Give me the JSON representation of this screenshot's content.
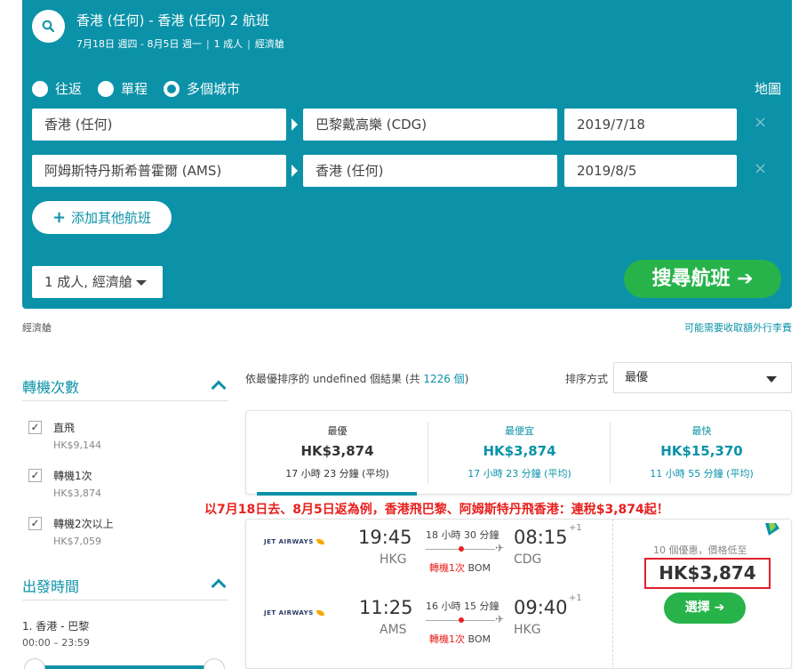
{
  "search": {
    "route_title": "香港 (任何) - 香港 (任何) 2 航班",
    "dates": "7月18日 週四 - 8月5日 週一",
    "pax": "1 成人",
    "cabin": "經濟艙"
  },
  "trip_types": [
    {
      "label": "往返",
      "selected": false
    },
    {
      "label": "單程",
      "selected": false
    },
    {
      "label": "多個城市",
      "selected": true
    }
  ],
  "map_label": "地圖",
  "legs": [
    {
      "from": "香港 (任何)",
      "to": "巴黎戴高樂 (CDG)",
      "date": "2019/7/18"
    },
    {
      "from": "阿姆斯特丹斯希普霍爾 (AMS)",
      "to": "香港 (任何)",
      "date": "2019/8/5"
    }
  ],
  "remove_symbol": "×",
  "add_flight_label": "添加其他航班",
  "pax_select": "1 成人, 經濟艙",
  "search_button": "搜尋航班",
  "cabin_note": "經濟艙",
  "baggage_note": "可能需要收取額外行李費",
  "filters": {
    "stops_title": "轉機次數",
    "stops": [
      {
        "label": "直飛",
        "price": "HK$9,144",
        "checked": true
      },
      {
        "label": "轉機1次",
        "price": "HK$3,874",
        "checked": true
      },
      {
        "label": "轉機2次以上",
        "price": "HK$7,059",
        "checked": true
      }
    ],
    "departure_title": "出發時間",
    "departure_route": "1. 香港 - 巴黎",
    "departure_range": "00:00 – 23:59"
  },
  "results": {
    "info_prefix": "依最優排序的 undefined 個結果 (共 ",
    "count": "1226 個",
    "info_suffix": ")",
    "sort_label": "排序方式",
    "sort_value": "最優"
  },
  "tabs": [
    {
      "title": "最優",
      "price": "HK$3,874",
      "duration": "17 小時 23 分鐘 (平均)"
    },
    {
      "title": "最便宜",
      "price": "HK$3,874",
      "duration": "17 小時 23 分鐘 (平均)"
    },
    {
      "title": "最快",
      "price": "HK$15,370",
      "duration": "11 小時 55 分鐘 (平均)"
    }
  ],
  "promo_text": "以7月18日去、8月5日返為例，香港飛巴黎、阿姆斯特丹飛香港：連稅$3,874起！",
  "itinerary": {
    "flights": [
      {
        "airline": "JET AIRWAYS",
        "dep_time": "19:45",
        "dep_airport": "HKG",
        "duration": "18 小時 30 分鐘",
        "stops": "轉機1次",
        "via": "BOM",
        "arr_time": "08:15",
        "arr_offset": "+1",
        "arr_airport": "CDG"
      },
      {
        "airline": "JET AIRWAYS",
        "dep_time": "11:25",
        "dep_airport": "AMS",
        "duration": "16 小時 15 分鐘",
        "stops": "轉機1次",
        "via": "BOM",
        "arr_time": "09:40",
        "arr_offset": "+1",
        "arr_airport": "HKG"
      }
    ],
    "deals": "10 個優惠，價格低至",
    "price": "HK$3,874",
    "select_label": "選擇"
  },
  "colors": {
    "teal": "#0b92a8",
    "green": "#27b34a",
    "red": "#e8201d"
  }
}
